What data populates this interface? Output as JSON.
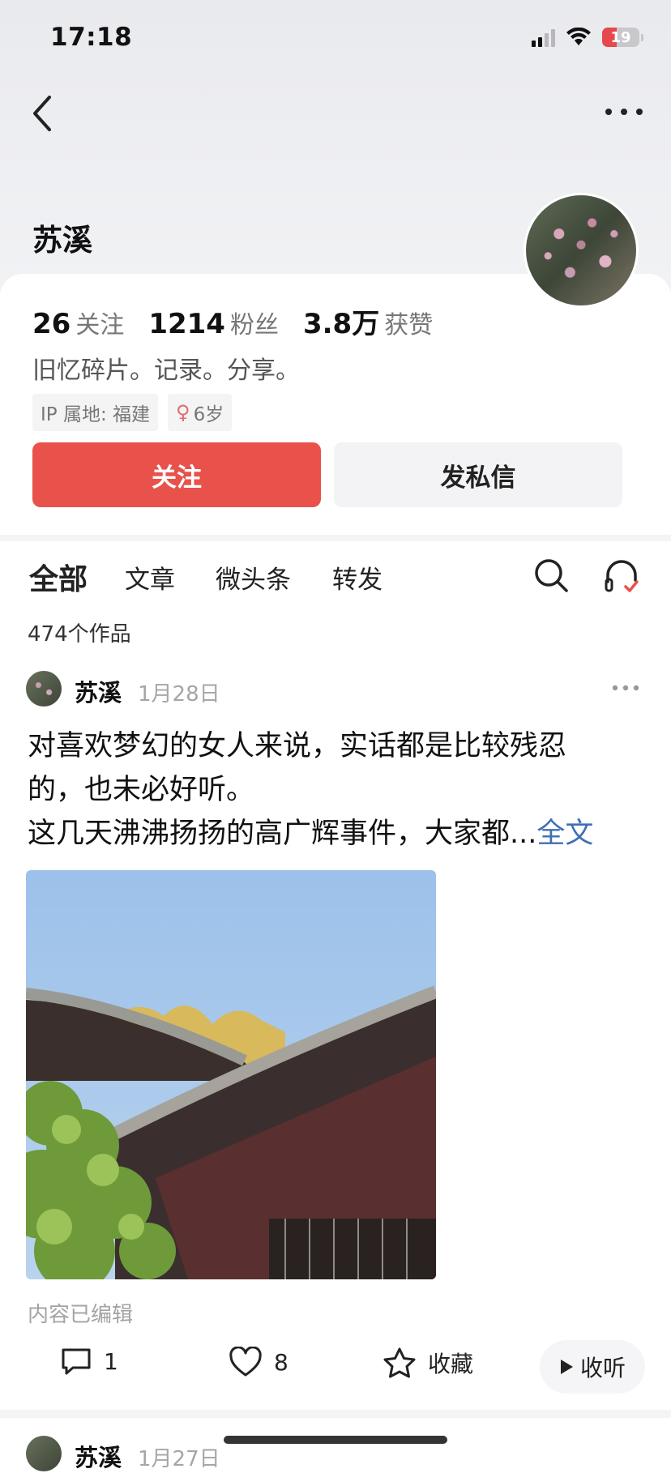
{
  "status_bar": {
    "time": "17:18",
    "battery": "19"
  },
  "header": {
    "back_icon": "chevron-left-icon",
    "more_icon": "more-horizontal-icon"
  },
  "profile": {
    "name": "苏溪",
    "stats": [
      {
        "num": "26",
        "label": "关注"
      },
      {
        "num": "1214",
        "label": "粉丝"
      },
      {
        "num": "3.8万",
        "label": "获赞"
      }
    ],
    "bio": "旧忆碎片。记录。分享。",
    "tags": {
      "ip": "IP 属地: 福建",
      "gender_symbol": "♀",
      "age": "6岁"
    },
    "follow_label": "关注",
    "message_label": "发私信"
  },
  "tabs": [
    {
      "label": "全部",
      "active": true
    },
    {
      "label": "文章"
    },
    {
      "label": "微头条"
    },
    {
      "label": "转发"
    }
  ],
  "works_count": "474个作品",
  "post": {
    "author": "苏溪",
    "date": "1月28日",
    "text_line1": "对喜欢梦幻的女人来说，实话都是比较残忍",
    "text_line2": "的，也未必好听。",
    "text_line3": "这几天沸沸扬扬的高广辉事件，大家都...",
    "read_more": "全文",
    "edited": "内容已编辑",
    "comments": "1",
    "likes": "8",
    "favorite_label": "收藏",
    "listen_label": "收听"
  },
  "next_post": {
    "author": "苏溪",
    "date": "1月27日"
  },
  "colors": {
    "accent": "#e8524a",
    "link": "#3f6fb5"
  }
}
